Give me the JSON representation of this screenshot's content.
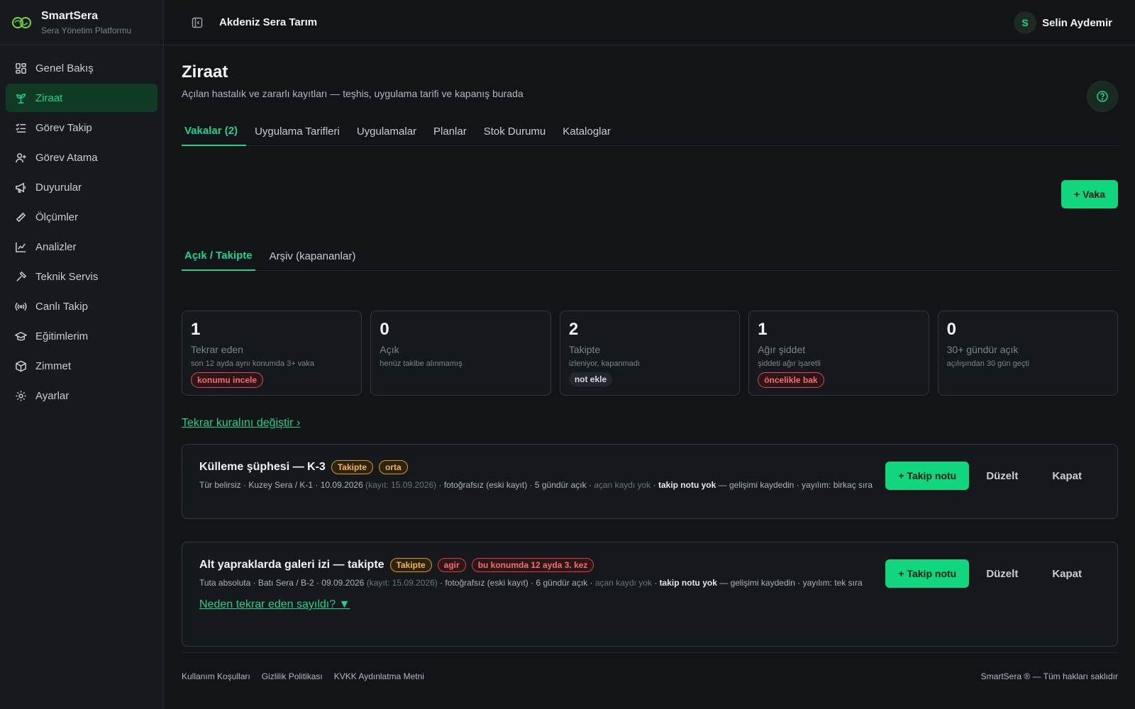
{
  "brand": {
    "name": "SmartSera",
    "subtitle": "Sera Yönetim Platformu"
  },
  "topbar": {
    "org": "Akdeniz Sera Tarım",
    "user_initial": "S",
    "user_name": "Selin Aydemir"
  },
  "sidebar": {
    "items": [
      {
        "label": "Genel Bakış",
        "icon": "dashboard-icon"
      },
      {
        "label": "Ziraat",
        "icon": "sprout-icon",
        "active": true
      },
      {
        "label": "Görev Takip",
        "icon": "checklist-icon"
      },
      {
        "label": "Görev Atama",
        "icon": "user-plus-icon"
      },
      {
        "label": "Duyurular",
        "icon": "megaphone-icon"
      },
      {
        "label": "Ölçümler",
        "icon": "ruler-icon"
      },
      {
        "label": "Analizler",
        "icon": "line-chart-icon"
      },
      {
        "label": "Teknik Servis",
        "icon": "hammer-icon"
      },
      {
        "label": "Canlı Takip",
        "icon": "broadcast-icon"
      },
      {
        "label": "Eğitimlerim",
        "icon": "graduation-cap-icon"
      },
      {
        "label": "Zimmet",
        "icon": "box-icon"
      },
      {
        "label": "Ayarlar",
        "icon": "gear-icon"
      }
    ]
  },
  "page": {
    "title": "Ziraat",
    "subtitle": "Açılan hastalık ve zararlı kayıtları — teşhis, uygulama tarifi ve kapanış burada"
  },
  "tabs": [
    "Vakalar (2)",
    "Uygulama Tarifleri",
    "Uygulamalar",
    "Planlar",
    "Stok Durumu",
    "Kataloglar"
  ],
  "toolbar": {
    "add_case": "+ Vaka"
  },
  "subtabs": [
    "Açık / Takipte",
    "Arşiv (kapananlar)"
  ],
  "stats": [
    {
      "value": "1",
      "label": "Tekrar eden",
      "hint": "son 12 ayda aynı konumda 3+ vaka",
      "pill": "konumu incele",
      "pill_style": "red"
    },
    {
      "value": "0",
      "label": "Açık",
      "hint": "henüz takibe alınmamış",
      "pill": "",
      "pill_style": ""
    },
    {
      "value": "2",
      "label": "Takipte",
      "hint": "izleniyor, kapanmadı",
      "pill": "not ekle",
      "pill_style": "gray"
    },
    {
      "value": "1",
      "label": "Ağır şiddet",
      "hint": "şiddeti ağır işaretli",
      "pill": "öncelikle bak",
      "pill_style": "red"
    },
    {
      "value": "0",
      "label": "30+ gündür açık",
      "hint": "açılışından 30 gün geçti",
      "pill": "",
      "pill_style": ""
    }
  ],
  "rule_link": "Tekrar kuralını değiştir ›",
  "cases": [
    {
      "title": "Külleme şüphesi — K-3",
      "tags": [
        {
          "text": "Takipte",
          "style": "yellow"
        },
        {
          "text": "orta",
          "style": "yellow"
        }
      ],
      "meta_a": "Tür belirsiz · Kuzey Sera / K-1 · 10.09.2026 ",
      "meta_b": "(kayıt: 15.09.2026)",
      "meta_c": " · fotoğrafsız (eski kayıt) · 5 gündür açık · ",
      "meta_d": "açan kaydı yok",
      "meta_e": " · ",
      "meta_f": "takip notu yok",
      "meta_g": " — gelişimi kaydedin · yayılım: birkaç sıra",
      "link": ""
    },
    {
      "title": "Alt yapraklarda galeri izi — takipte",
      "tags": [
        {
          "text": "Takipte",
          "style": "yellow"
        },
        {
          "text": "agir",
          "style": "red"
        },
        {
          "text": "bu konumda 12 ayda 3. kez",
          "style": "red"
        }
      ],
      "meta_a": "Tuta absoluta · Batı Sera / B-2 · 09.09.2026 ",
      "meta_b": "(kayıt: 15.09.2026)",
      "meta_c": " · fotoğrafsız (eski kayıt) · 6 gündür açık · ",
      "meta_d": "açan kaydı yok",
      "meta_e": " · ",
      "meta_f": "takip notu yok",
      "meta_g": " — gelişimi kaydedin · yayılım: tek sıra",
      "link": "Neden tekrar eden sayıldı? ▼"
    }
  ],
  "case_actions": {
    "follow": "+ Takip notu",
    "edit": "Düzelt",
    "close": "Kapat"
  },
  "footer": {
    "links": [
      "Kullanım Koşulları",
      "Gizlilik Politikası",
      "KVKK Aydınlatma Metni"
    ],
    "copyright": "SmartSera ® — Tüm hakları saklıdır"
  },
  "colors": {
    "accent": "#1fd38a",
    "primary_button": "#10d77e",
    "warning": "#f5b83d",
    "danger": "#ff6b6b",
    "background": "#121418"
  }
}
